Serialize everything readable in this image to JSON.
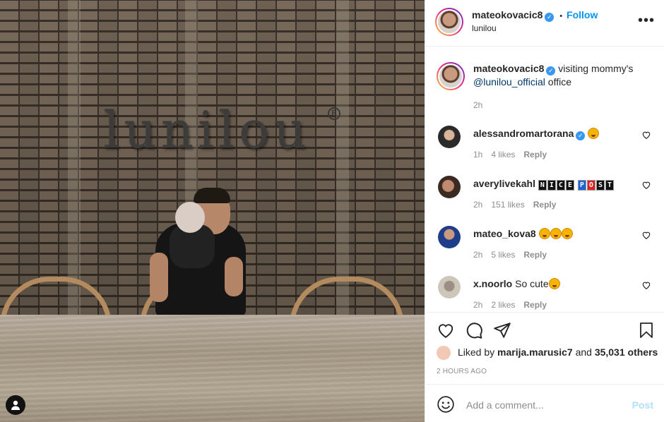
{
  "post": {
    "photo": {
      "sign_text": "lunilou",
      "sign_mark": "R"
    }
  },
  "header": {
    "username": "mateokovacic8",
    "verified_icon": "verified-badge-icon",
    "separator": "•",
    "follow_label": "Follow",
    "subtitle": "lunilou",
    "more_icon": "more-options-icon"
  },
  "caption": {
    "username": "mateokovacic8",
    "text_before": "visiting mommy's",
    "mention": "@lunilou_official",
    "text_after": "office",
    "time": "2h"
  },
  "comments": [
    {
      "username": "alessandromartorana",
      "verified": true,
      "text": "",
      "emoji_count": 1,
      "time": "1h",
      "likes": "4 likes",
      "reply": "Reply"
    },
    {
      "username": "averylivekahl",
      "verified": false,
      "text": "",
      "boxes1": [
        "N",
        "I",
        "C",
        "E"
      ],
      "boxes2": [
        "P",
        "O",
        "S",
        "T"
      ],
      "time": "2h",
      "likes": "151 likes",
      "reply": "Reply"
    },
    {
      "username": "mateo_kova8",
      "verified": false,
      "text": "",
      "emoji_count": 3,
      "time": "2h",
      "likes": "5 likes",
      "reply": "Reply"
    },
    {
      "username": "x.noorlo",
      "verified": false,
      "text": "So cute",
      "emoji_count": 1,
      "time": "2h",
      "likes": "2 likes",
      "reply": "Reply"
    }
  ],
  "actions": {
    "like_icon": "heart-icon",
    "comment_icon": "comment-icon",
    "share_icon": "share-icon",
    "save_icon": "bookmark-icon",
    "liked_by_prefix": "Liked by",
    "liked_by_user": "marija.marusic7",
    "liked_by_and": "and",
    "liked_by_others": "35,031 others",
    "time_ago": "2 HOURS AGO"
  },
  "add_comment": {
    "emoji_icon": "emoji-icon",
    "placeholder": "Add a comment...",
    "post_label": "Post"
  },
  "colors": {
    "accent": "#0095f6",
    "post_disabled": "#b2dffc",
    "muted": "#8e8e8e"
  }
}
